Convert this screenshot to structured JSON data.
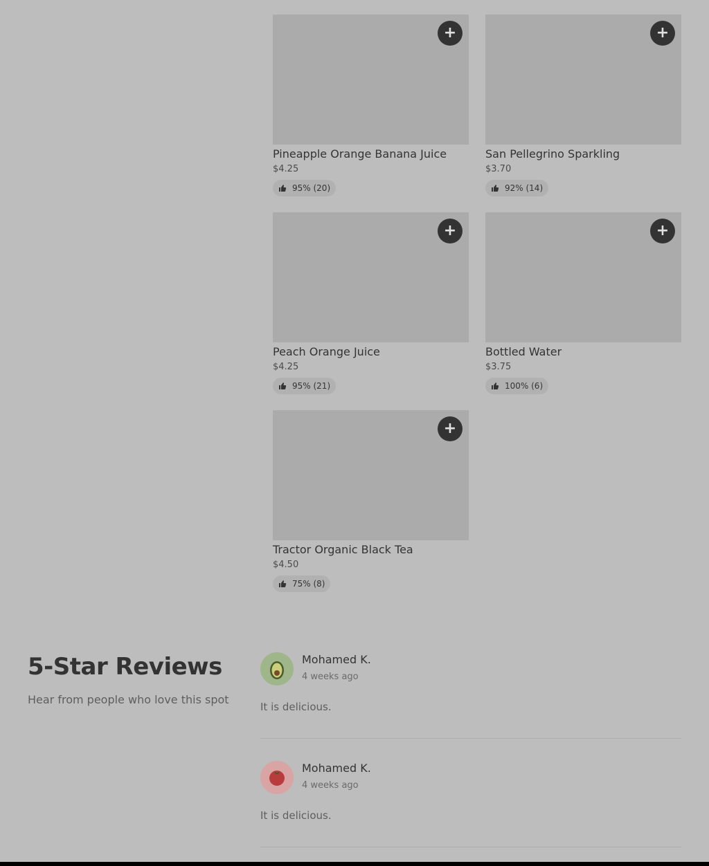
{
  "products": [
    {
      "name": "Pineapple Orange Banana Juice",
      "price": "$4.25",
      "rating": "95% (20)",
      "add_icon": "plus-icon"
    },
    {
      "name": "San Pellegrino Sparkling",
      "price": "$3.70",
      "rating": "92% (14)",
      "add_icon": "plus-icon"
    },
    {
      "name": "Peach Orange Juice",
      "price": "$4.25",
      "rating": "95% (21)",
      "add_icon": "plus-icon"
    },
    {
      "name": "Bottled Water",
      "price": "$3.75",
      "rating": "100% (6)",
      "add_icon": "plus-icon"
    },
    {
      "name": "Tractor Organic Black Tea",
      "price": "$4.50",
      "rating": "75% (8)",
      "add_icon": "plus-icon"
    }
  ],
  "reviews_section": {
    "title": "5-Star Reviews",
    "subtitle": "Hear from people who love this spot"
  },
  "reviews": [
    {
      "name": "Mohamed K.",
      "time": "4 weeks ago",
      "text": "It is delicious.",
      "avatar": "avocado-icon",
      "avatar_bg": "#9fb58a"
    },
    {
      "name": "Mohamed K.",
      "time": "4 weeks ago",
      "text": "It is delicious.",
      "avatar": "tomato-icon",
      "avatar_bg": "#d8a4a4"
    }
  ],
  "colors": {
    "background": "#bdbdbd",
    "card_image": "#ababab",
    "add_button": "#333333"
  }
}
